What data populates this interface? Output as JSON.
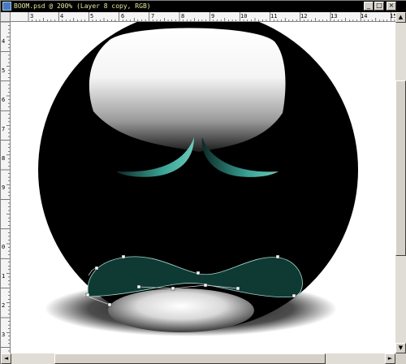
{
  "window": {
    "title": "BOOM.psd @ 200% (Layer 8 copy, RGB)",
    "controls": {
      "minimize": "_",
      "maximize": "□",
      "close": "×"
    }
  },
  "rulers": {
    "top_labels": [
      "3",
      "4",
      "5",
      "6",
      "7",
      "8",
      "9",
      "10",
      "11",
      "12",
      "13",
      "14",
      "15"
    ],
    "left_labels": [
      "4",
      "5",
      "6",
      "7",
      "8",
      "9",
      "0",
      "1",
      "2",
      "3"
    ]
  },
  "scrollbars": {
    "up": "▲",
    "down": "▼",
    "left": "◄",
    "right": "►"
  },
  "colors": {
    "title_bar": "#000000",
    "title_text": "#e8e8a0",
    "ball": "#000000",
    "mouth_fill": "#0f3a34",
    "eyebrow": "#3aa396"
  },
  "icons": [
    "document-icon",
    "minimize-icon",
    "maximize-icon",
    "close-icon"
  ]
}
